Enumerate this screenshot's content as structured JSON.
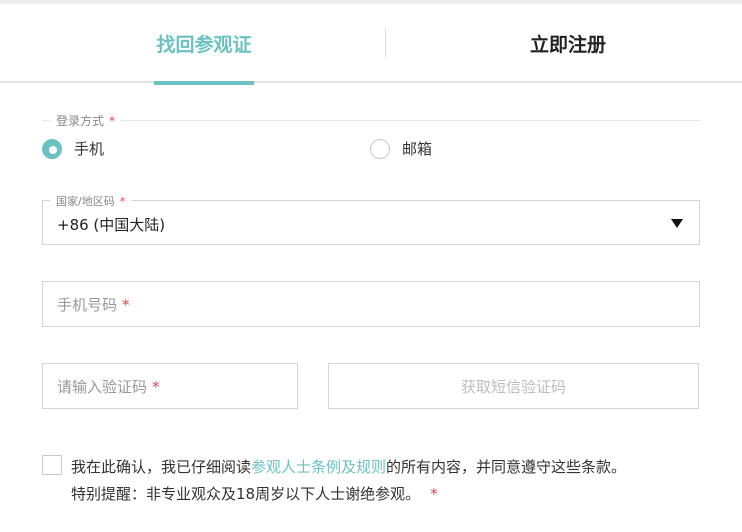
{
  "tabs": {
    "recover": "找回参观证",
    "register": "立即注册"
  },
  "login_method": {
    "label": "登录方式",
    "required_mark": "*",
    "options": [
      {
        "label": "手机",
        "selected": true
      },
      {
        "label": "邮箱",
        "selected": false
      }
    ]
  },
  "region": {
    "label": "国家/地区码",
    "required_mark": "*",
    "value": "+86 (中国大陆)"
  },
  "phone": {
    "placeholder": "手机号码",
    "required_mark": "*"
  },
  "code": {
    "placeholder": "请输入验证码",
    "required_mark": "*",
    "send_button": "获取短信验证码"
  },
  "agreement": {
    "prefix": "我在此确认，我已仔细阅读",
    "link": "参观人士条例及规则",
    "suffix": "的所有内容，并同意遵守这些条款。",
    "notice": "特别提醒：非专业观众及18周岁以下人士谢绝参观。",
    "required_mark": "*"
  },
  "colors": {
    "accent": "#6ac2c2",
    "required": "#e5434d"
  }
}
